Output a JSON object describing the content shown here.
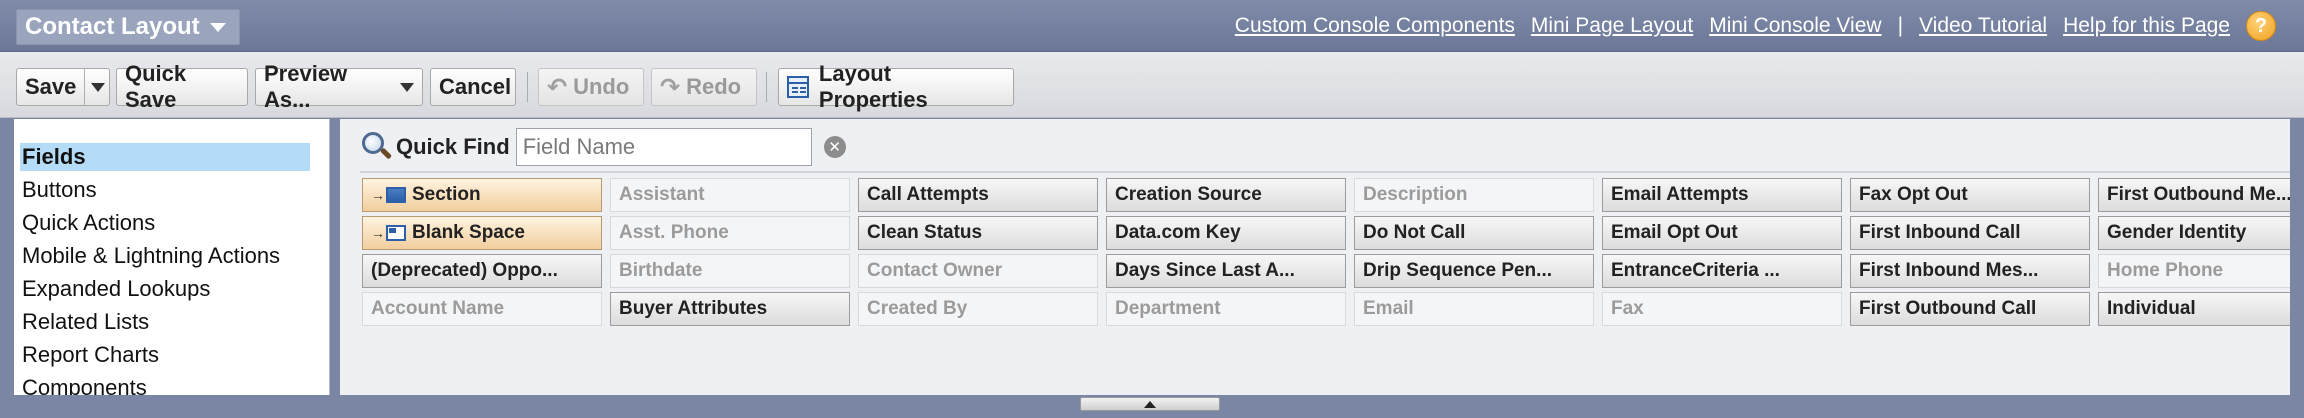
{
  "header": {
    "title": "Contact Layout",
    "links": [
      "Custom Console Components",
      "Mini Page Layout",
      "Mini Console View",
      "Video Tutorial",
      "Help for this Page"
    ],
    "separator": "|",
    "help_glyph": "?"
  },
  "toolbar": {
    "save": "Save",
    "quick_save": "Quick Save",
    "preview_as": "Preview As...",
    "cancel": "Cancel",
    "undo": "Undo",
    "redo": "Redo",
    "layout_properties": "Layout Properties"
  },
  "sidebar": {
    "items": [
      "Fields",
      "Buttons",
      "Quick Actions",
      "Mobile & Lightning Actions",
      "Expanded Lookups",
      "Related Lists",
      "Report Charts",
      "Components"
    ]
  },
  "quickfind": {
    "label": "Quick Find",
    "placeholder": "Field Name"
  },
  "palette": {
    "columns": [
      [
        {
          "label": "Section",
          "state": "special",
          "icon": "section-icon"
        },
        {
          "label": "Blank Space",
          "state": "special",
          "icon": "blank-space-icon"
        },
        {
          "label": "(Deprecated) Oppo...",
          "state": "avail"
        },
        {
          "label": "Account Name",
          "state": "used"
        }
      ],
      [
        {
          "label": "Assistant",
          "state": "used"
        },
        {
          "label": "Asst. Phone",
          "state": "used"
        },
        {
          "label": "Birthdate",
          "state": "used"
        },
        {
          "label": "Buyer Attributes",
          "state": "avail"
        }
      ],
      [
        {
          "label": "Call Attempts",
          "state": "avail"
        },
        {
          "label": "Clean Status",
          "state": "avail"
        },
        {
          "label": "Contact Owner",
          "state": "used"
        },
        {
          "label": "Created By",
          "state": "used"
        }
      ],
      [
        {
          "label": "Creation Source",
          "state": "avail"
        },
        {
          "label": "Data.com Key",
          "state": "avail"
        },
        {
          "label": "Days Since Last A...",
          "state": "avail"
        },
        {
          "label": "Department",
          "state": "used"
        }
      ],
      [
        {
          "label": "Description",
          "state": "used"
        },
        {
          "label": "Do Not Call",
          "state": "avail"
        },
        {
          "label": "Drip Sequence Pen...",
          "state": "avail"
        },
        {
          "label": "Email",
          "state": "used"
        }
      ],
      [
        {
          "label": "Email Attempts",
          "state": "avail"
        },
        {
          "label": "Email Opt Out",
          "state": "avail"
        },
        {
          "label": "EntranceCriteria ...",
          "state": "avail"
        },
        {
          "label": "Fax",
          "state": "used"
        }
      ],
      [
        {
          "label": "Fax Opt Out",
          "state": "avail"
        },
        {
          "label": "First Inbound Call",
          "state": "avail"
        },
        {
          "label": "First Inbound Mes...",
          "state": "avail"
        },
        {
          "label": "First Outbound Call",
          "state": "avail"
        }
      ],
      [
        {
          "label": "First Outbound Me...",
          "state": "avail"
        },
        {
          "label": "Gender Identity",
          "state": "avail"
        },
        {
          "label": "Home Phone",
          "state": "used"
        },
        {
          "label": "Individual",
          "state": "avail"
        }
      ]
    ]
  }
}
